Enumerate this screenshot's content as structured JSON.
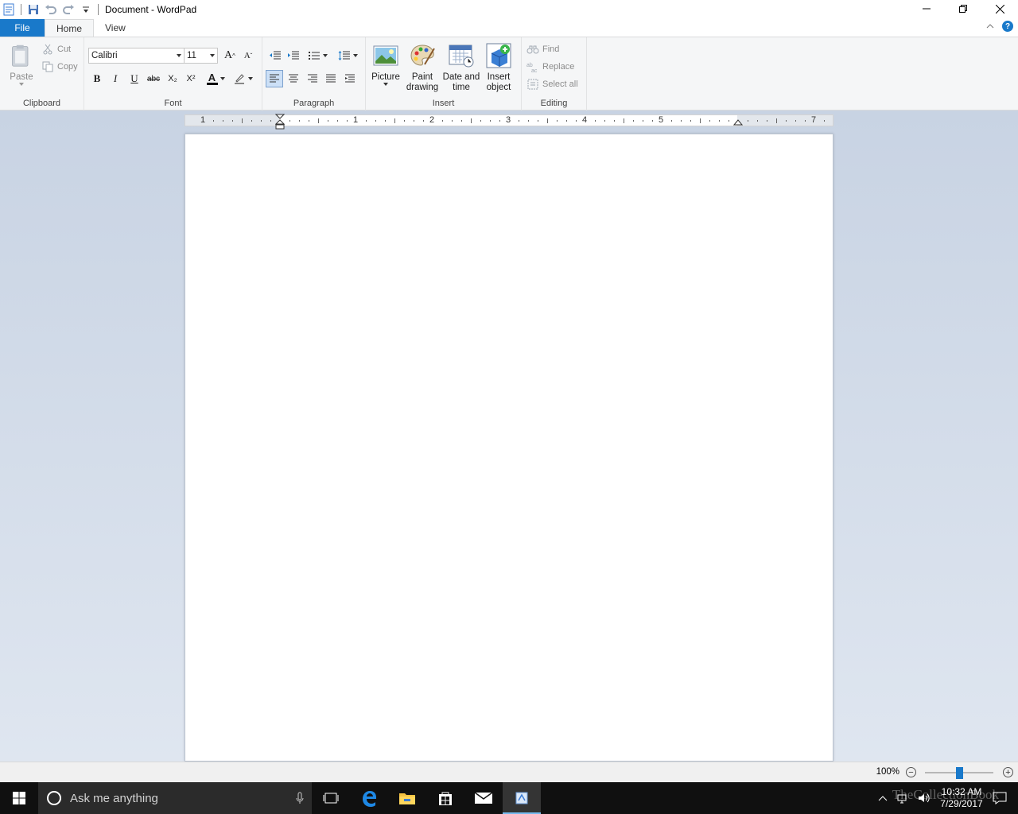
{
  "window": {
    "title": "Document - WordPad"
  },
  "tabs": {
    "file": "File",
    "home": "Home",
    "view": "View",
    "help": "?"
  },
  "clipboard": {
    "paste": "Paste",
    "cut": "Cut",
    "copy": "Copy",
    "group_label": "Clipboard"
  },
  "font": {
    "family": "Calibri",
    "size": "11",
    "grow": "A",
    "shrink": "A",
    "bold": "B",
    "italic": "I",
    "underline": "U",
    "strike": "abc",
    "subscript": "X₂",
    "superscript": "X²",
    "color_letter": "A",
    "text_color": "#000000",
    "group_label": "Font"
  },
  "paragraph": {
    "group_label": "Paragraph"
  },
  "insert": {
    "picture": "Picture",
    "paint_drawing_1": "Paint",
    "paint_drawing_2": "drawing",
    "date_time_1": "Date and",
    "date_time_2": "time",
    "insert_object_1": "Insert",
    "insert_object_2": "object",
    "group_label": "Insert"
  },
  "editing": {
    "find": "Find",
    "replace": "Replace",
    "select_all": "Select all",
    "group_label": "Editing"
  },
  "ruler": {
    "labels": [
      "1",
      "1",
      "2",
      "3",
      "4",
      "5",
      "7"
    ]
  },
  "statusbar": {
    "zoom": "100%",
    "zoom_out": "−",
    "zoom_in": "+",
    "zoom_level": 1.0
  },
  "taskbar": {
    "search_placeholder": "Ask me anything",
    "time": "10:32 AM",
    "date": "7/29/2017",
    "watermark": "TheCollectionBook"
  },
  "colors": {
    "accent": "#1979ca",
    "ribbon_bg": "#f5f6f7",
    "workspace_bg": "#c8d3e3",
    "taskbar_bg": "#101010"
  }
}
